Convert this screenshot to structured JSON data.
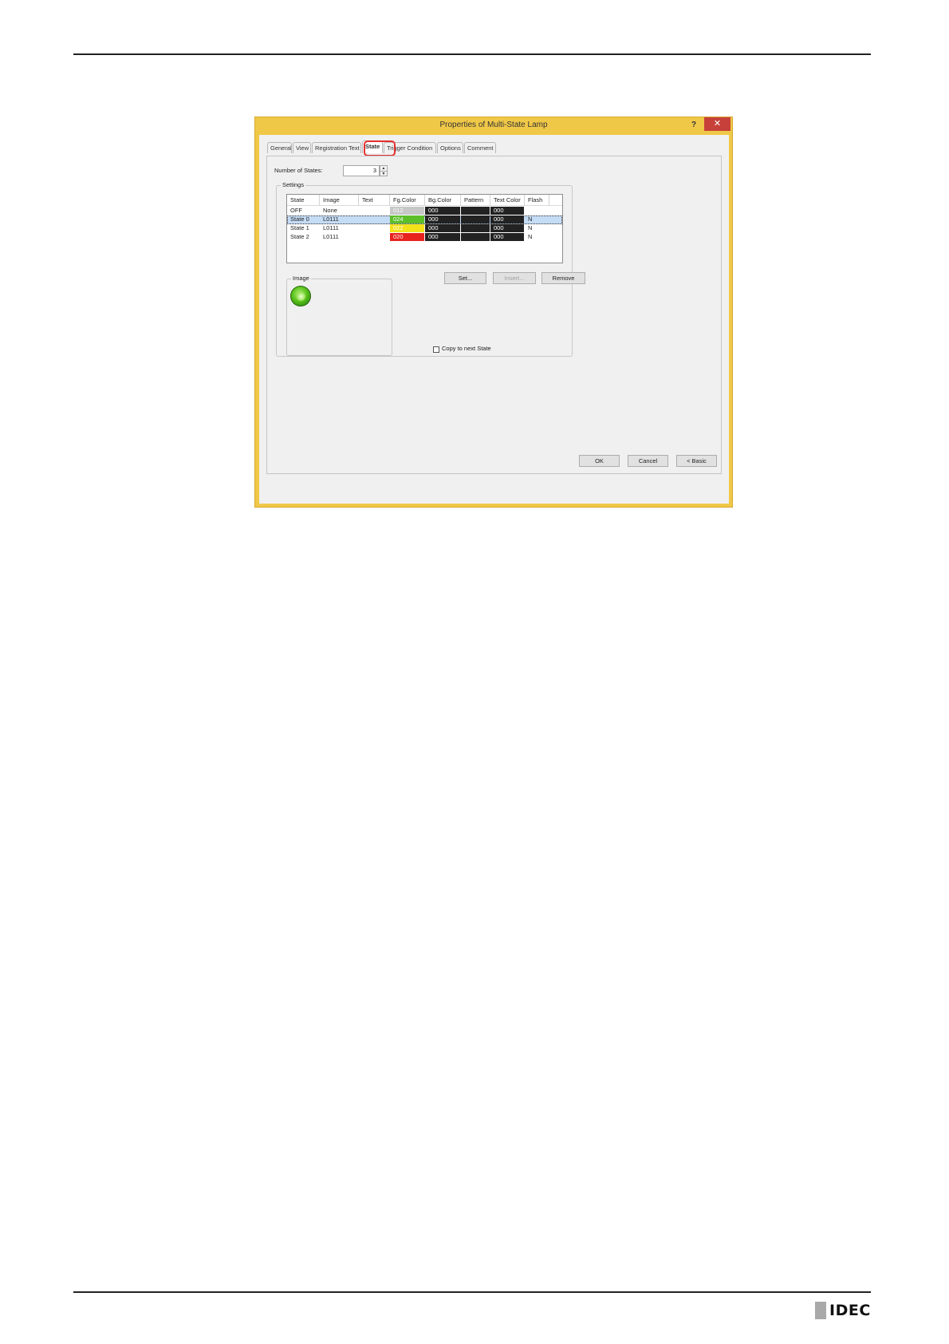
{
  "page": {
    "brand": "IDEC"
  },
  "window": {
    "title": "Properties of Multi-State Lamp",
    "help_label": "?",
    "close_label": "✕"
  },
  "tabs": [
    {
      "label": "General",
      "active": false
    },
    {
      "label": "View",
      "active": false
    },
    {
      "label": "Registration Text",
      "active": false
    },
    {
      "label": "State",
      "active": true
    },
    {
      "label": "Trigger Condition",
      "active": false
    },
    {
      "label": "Options",
      "active": false
    },
    {
      "label": "Comment",
      "active": false
    }
  ],
  "state_tab": {
    "number_of_states_label": "Number of States:",
    "number_of_states_value": "3",
    "settings_label": "Settings",
    "columns": [
      "State",
      "Image",
      "Text",
      "Fg.Color",
      "Bg.Color",
      "Pattern",
      "Text Color",
      "Flash"
    ],
    "rows": [
      {
        "state": "OFF",
        "image": "None",
        "text": "",
        "fg_color": "012",
        "fg_hex": "#c7c7c7",
        "bg_color": "000",
        "pattern": "",
        "text_color": "000",
        "flash": "",
        "selected": false
      },
      {
        "state": "State 0",
        "image": "L0111",
        "text": "",
        "fg_color": "024",
        "fg_hex": "#5cbf2a",
        "bg_color": "000",
        "pattern": "",
        "text_color": "000",
        "flash": "N",
        "selected": true
      },
      {
        "state": "State 1",
        "image": "L0111",
        "text": "",
        "fg_color": "022",
        "fg_hex": "#f2e21a",
        "bg_color": "000",
        "pattern": "",
        "text_color": "000",
        "flash": "N",
        "selected": false
      },
      {
        "state": "State 2",
        "image": "L0111",
        "text": "",
        "fg_color": "020",
        "fg_hex": "#e8231e",
        "bg_color": "000",
        "pattern": "",
        "text_color": "000",
        "flash": "N",
        "selected": false
      }
    ],
    "buttons": {
      "set": "Set...",
      "insert": "Insert...",
      "remove": "Remove"
    },
    "image_label": "Image",
    "image_preview_icon": "green-lamp-icon",
    "copy_label": "Copy to next State",
    "copy_checked": false
  },
  "footer": {
    "ok": "OK",
    "cancel": "Cancel",
    "basic": "< Basic"
  },
  "colors": {
    "window_frame": "#f0c848",
    "close_button": "#c7403a",
    "highlight_ring": "#e53030",
    "selection": "#c5dcf5",
    "swatch_dark": "#222222"
  }
}
